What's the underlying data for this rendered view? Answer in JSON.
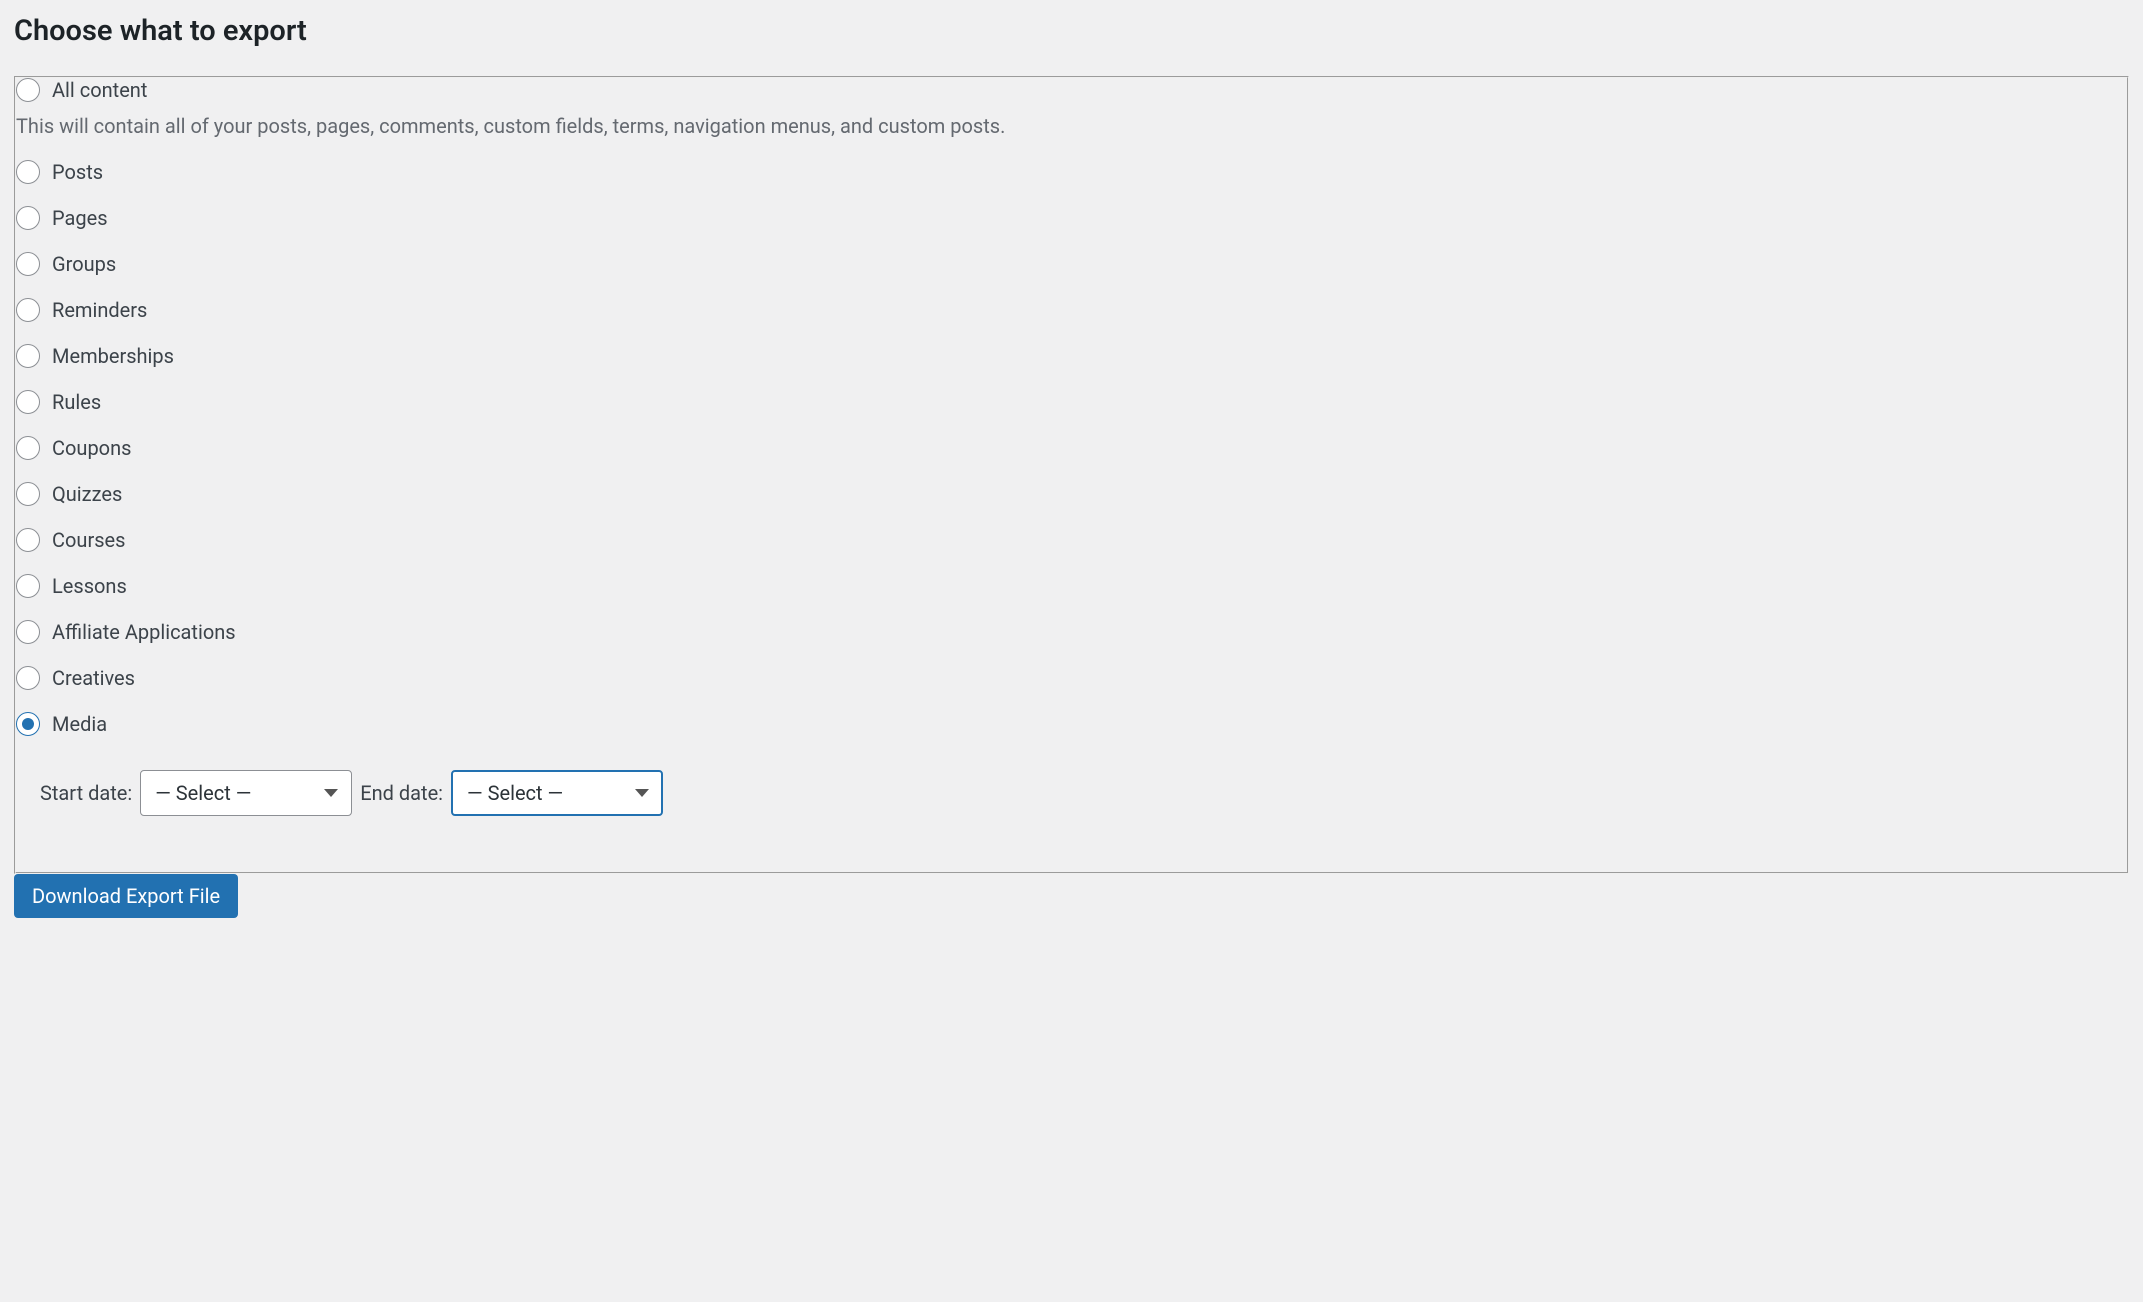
{
  "heading": "Choose what to export",
  "options": [
    {
      "key": "all",
      "label": "All content",
      "checked": false
    },
    {
      "key": "posts",
      "label": "Posts",
      "checked": false
    },
    {
      "key": "pages",
      "label": "Pages",
      "checked": false
    },
    {
      "key": "groups",
      "label": "Groups",
      "checked": false
    },
    {
      "key": "reminders",
      "label": "Reminders",
      "checked": false
    },
    {
      "key": "memberships",
      "label": "Memberships",
      "checked": false
    },
    {
      "key": "rules",
      "label": "Rules",
      "checked": false
    },
    {
      "key": "coupons",
      "label": "Coupons",
      "checked": false
    },
    {
      "key": "quizzes",
      "label": "Quizzes",
      "checked": false
    },
    {
      "key": "courses",
      "label": "Courses",
      "checked": false
    },
    {
      "key": "lessons",
      "label": "Lessons",
      "checked": false
    },
    {
      "key": "affiliate_applications",
      "label": "Affiliate Applications",
      "checked": false
    },
    {
      "key": "creatives",
      "label": "Creatives",
      "checked": false
    },
    {
      "key": "media",
      "label": "Media",
      "checked": true
    }
  ],
  "all_description": "This will contain all of your posts, pages, comments, custom fields, terms, navigation menus, and custom posts.",
  "date_filter": {
    "start_label": "Start date:",
    "end_label": "End date:",
    "start_value": "— Select —",
    "end_value": "— Select —"
  },
  "submit_label": "Download Export File"
}
